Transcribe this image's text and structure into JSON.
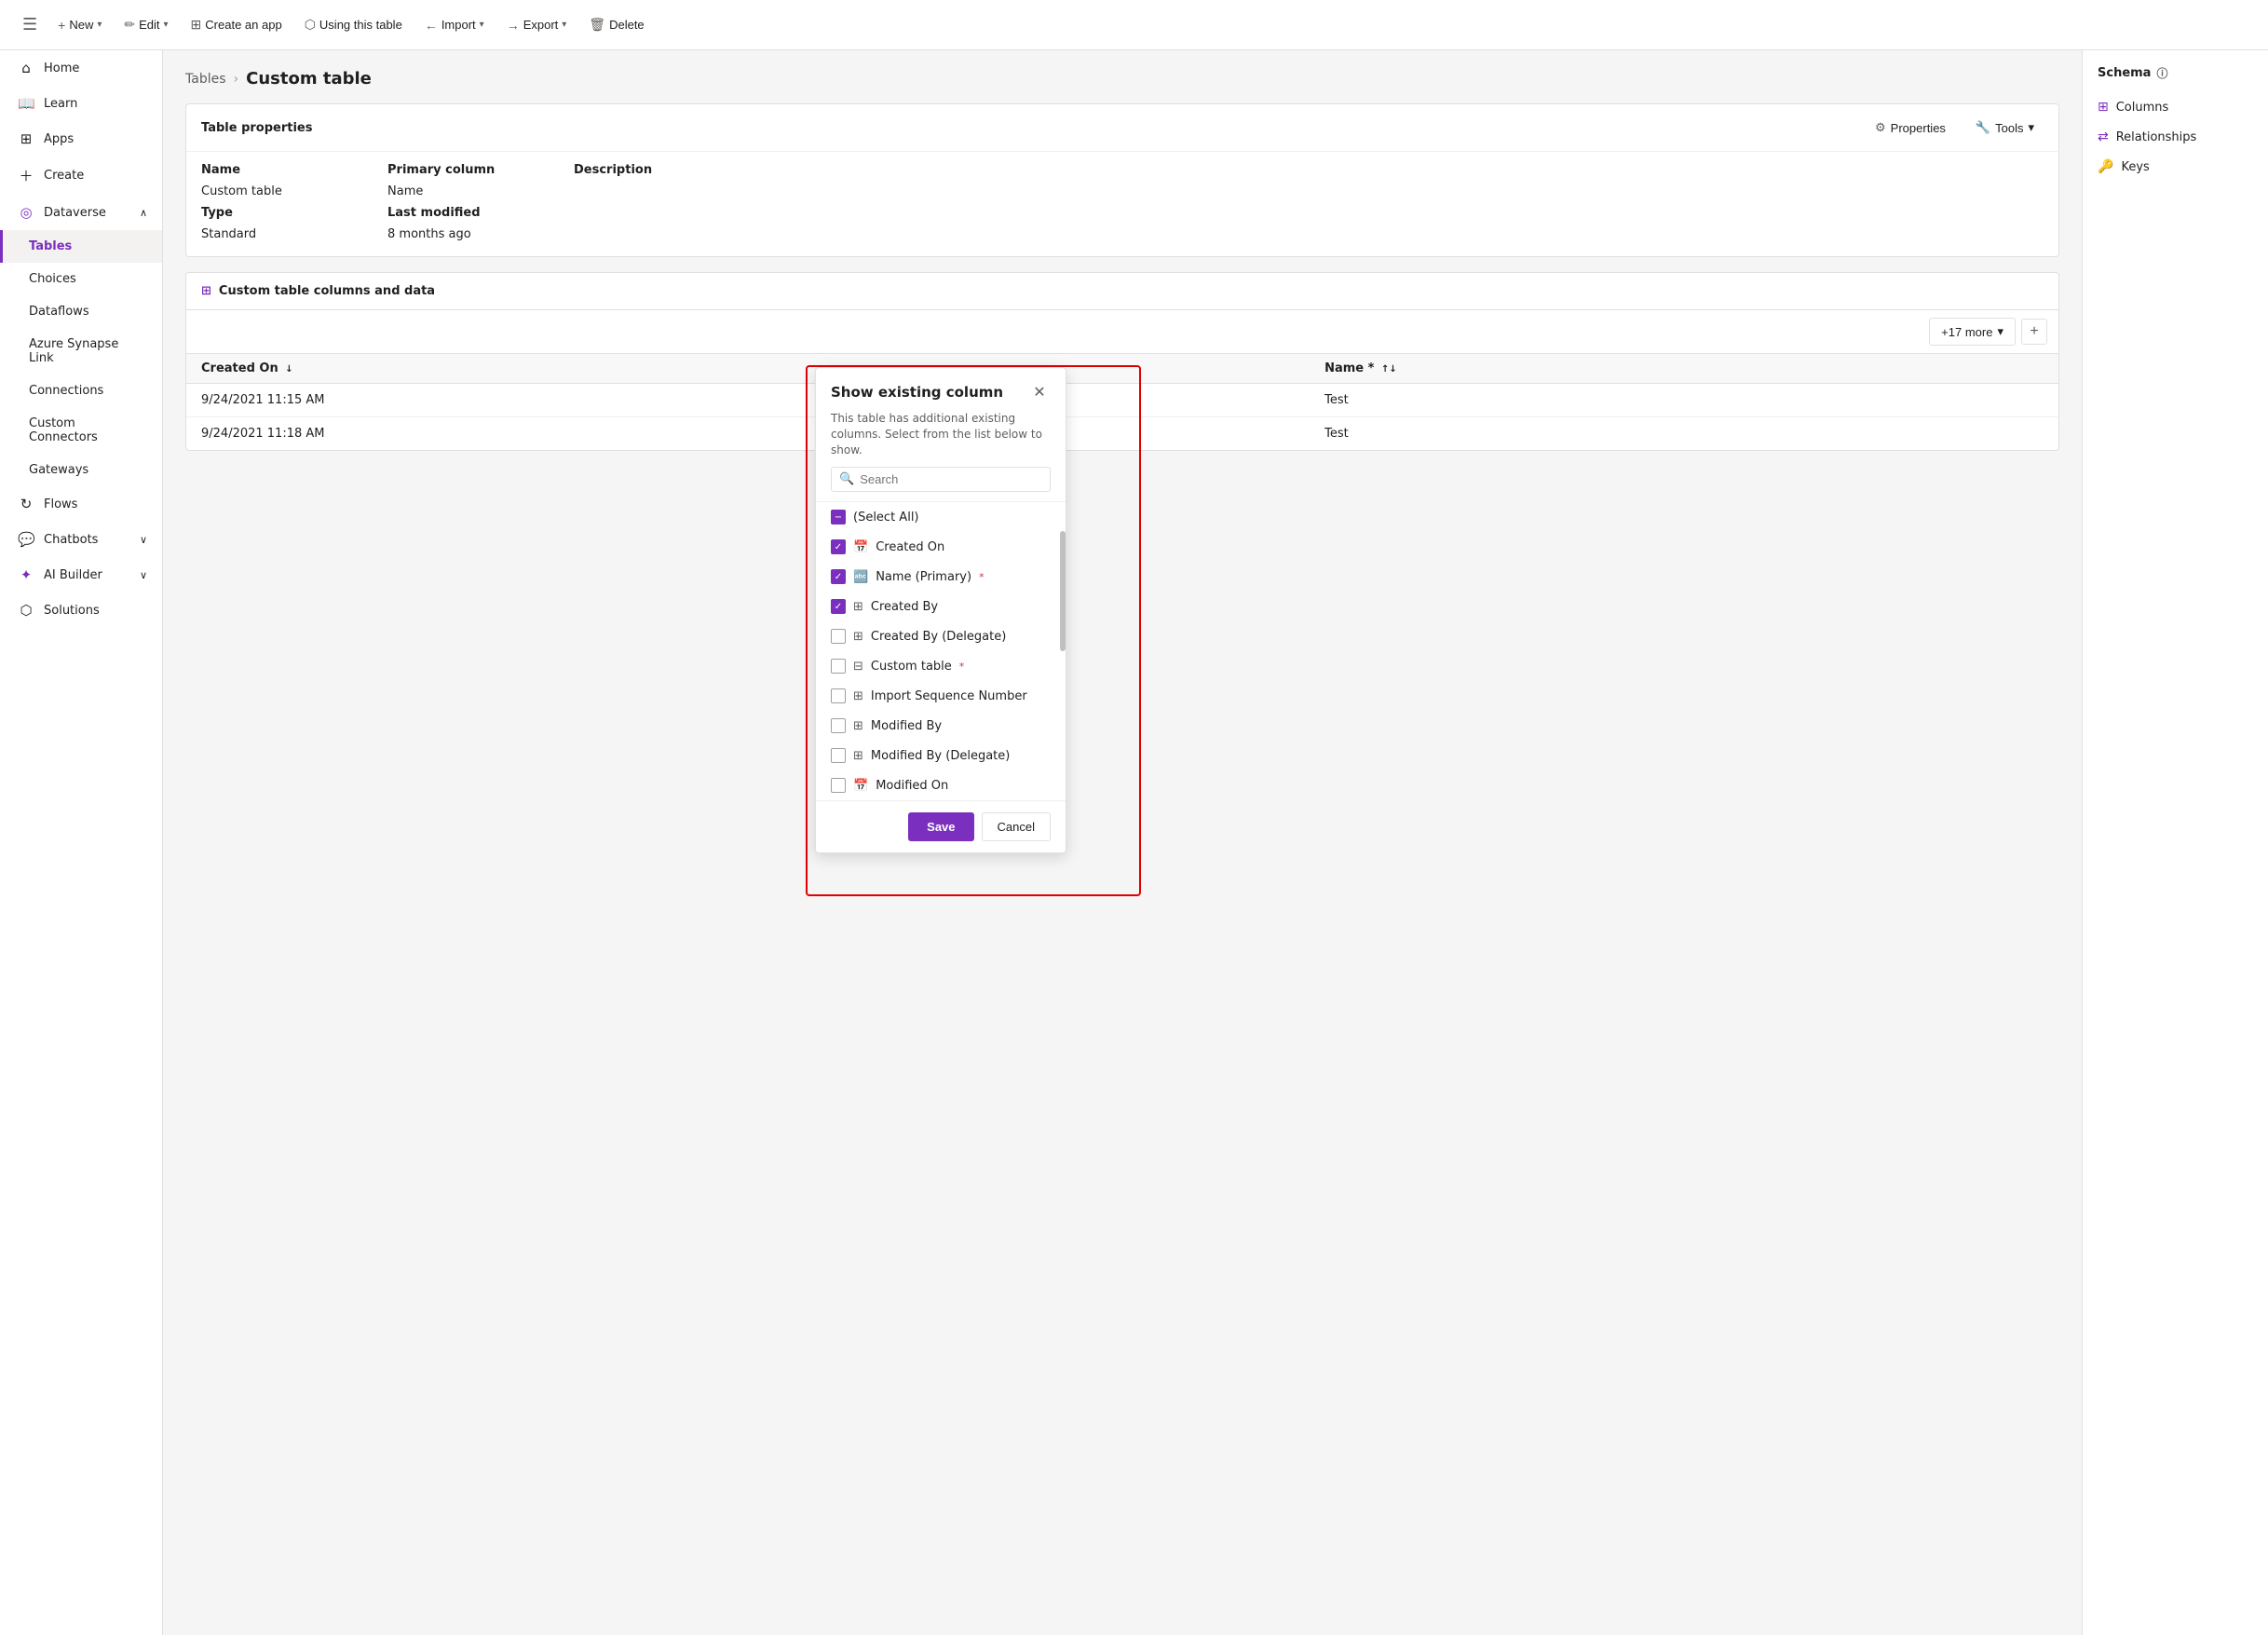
{
  "toolbar": {
    "hamburger": "☰",
    "new_label": "New",
    "edit_label": "Edit",
    "create_app_label": "Create an app",
    "using_table_label": "Using this table",
    "import_label": "Import",
    "export_label": "Export",
    "delete_label": "Delete"
  },
  "sidebar": {
    "items": [
      {
        "id": "home",
        "label": "Home",
        "icon": "⌂",
        "active": false
      },
      {
        "id": "learn",
        "label": "Learn",
        "icon": "📖",
        "active": false
      },
      {
        "id": "apps",
        "label": "Apps",
        "icon": "⊞",
        "active": false
      },
      {
        "id": "create",
        "label": "Create",
        "icon": "+",
        "active": false
      },
      {
        "id": "dataverse",
        "label": "Dataverse",
        "icon": "◎",
        "active": false,
        "expand": true
      },
      {
        "id": "tables",
        "label": "Tables",
        "icon": "",
        "active": true,
        "indent": true
      },
      {
        "id": "choices",
        "label": "Choices",
        "icon": "",
        "active": false,
        "indent": true
      },
      {
        "id": "dataflows",
        "label": "Dataflows",
        "icon": "",
        "active": false,
        "indent": true
      },
      {
        "id": "azure",
        "label": "Azure Synapse Link",
        "icon": "",
        "active": false,
        "indent": true
      },
      {
        "id": "connections",
        "label": "Connections",
        "icon": "",
        "active": false,
        "indent": true
      },
      {
        "id": "custom-connectors",
        "label": "Custom Connectors",
        "icon": "",
        "active": false,
        "indent": true
      },
      {
        "id": "gateways",
        "label": "Gateways",
        "icon": "",
        "active": false,
        "indent": true
      },
      {
        "id": "flows",
        "label": "Flows",
        "icon": "↻",
        "active": false
      },
      {
        "id": "chatbots",
        "label": "Chatbots",
        "icon": "💬",
        "active": false,
        "expand": true
      },
      {
        "id": "ai-builder",
        "label": "AI Builder",
        "icon": "✦",
        "active": false,
        "expand": true
      },
      {
        "id": "solutions",
        "label": "Solutions",
        "icon": "⬡",
        "active": false
      }
    ]
  },
  "breadcrumb": {
    "parent": "Tables",
    "current": "Custom table"
  },
  "table_properties": {
    "title": "Table properties",
    "properties_btn": "Properties",
    "tools_btn": "Tools",
    "name_label": "Name",
    "name_value": "Custom table",
    "primary_col_label": "Primary column",
    "primary_col_value": "Name",
    "description_label": "Description",
    "type_label": "Type",
    "type_value": "Standard",
    "last_modified_label": "Last modified",
    "last_modified_value": "8 months ago"
  },
  "data_table": {
    "title": "Custom table columns and data",
    "columns": [
      {
        "label": "Created On",
        "sort": "↓"
      },
      {
        "label": "Name *",
        "sort": "↑↓"
      }
    ],
    "rows": [
      {
        "created_on": "9/24/2021 11:15 AM",
        "name": "Test"
      },
      {
        "created_on": "9/24/2021 11:18 AM",
        "name": "Test"
      }
    ],
    "more_btn": "+17 more",
    "add_btn": "+"
  },
  "schema_panel": {
    "title": "Schema",
    "info_icon": "ⓘ",
    "items": [
      {
        "label": "Columns",
        "icon": "⊞"
      },
      {
        "label": "Relationships",
        "icon": "⇄"
      },
      {
        "label": "Keys",
        "icon": "🔑"
      }
    ]
  },
  "modal": {
    "title": "Show existing column",
    "subtitle": "This table has additional existing columns. Select from the list below to show.",
    "search_placeholder": "Search",
    "close_icon": "✕",
    "items": [
      {
        "label": "(Select All)",
        "icon": "",
        "checked": "partial",
        "required": false
      },
      {
        "label": "Created On",
        "icon": "📅",
        "checked": "true",
        "required": false
      },
      {
        "label": "Name (Primary)",
        "icon": "🔤",
        "checked": "true",
        "required": true
      },
      {
        "label": "Created By",
        "icon": "⊞",
        "checked": "true",
        "required": false
      },
      {
        "label": "Created By (Delegate)",
        "icon": "⊞",
        "checked": "false",
        "required": false
      },
      {
        "label": "Custom table",
        "icon": "⊞",
        "checked": "false",
        "required": true
      },
      {
        "label": "Import Sequence Number",
        "icon": "⊞",
        "checked": "false",
        "required": false
      },
      {
        "label": "Modified By",
        "icon": "⊞",
        "checked": "false",
        "required": false
      },
      {
        "label": "Modified By (Delegate)",
        "icon": "⊞",
        "checked": "false",
        "required": false
      },
      {
        "label": "Modified On",
        "icon": "📅",
        "checked": "false",
        "required": false
      }
    ],
    "save_btn": "Save",
    "cancel_btn": "Cancel"
  }
}
